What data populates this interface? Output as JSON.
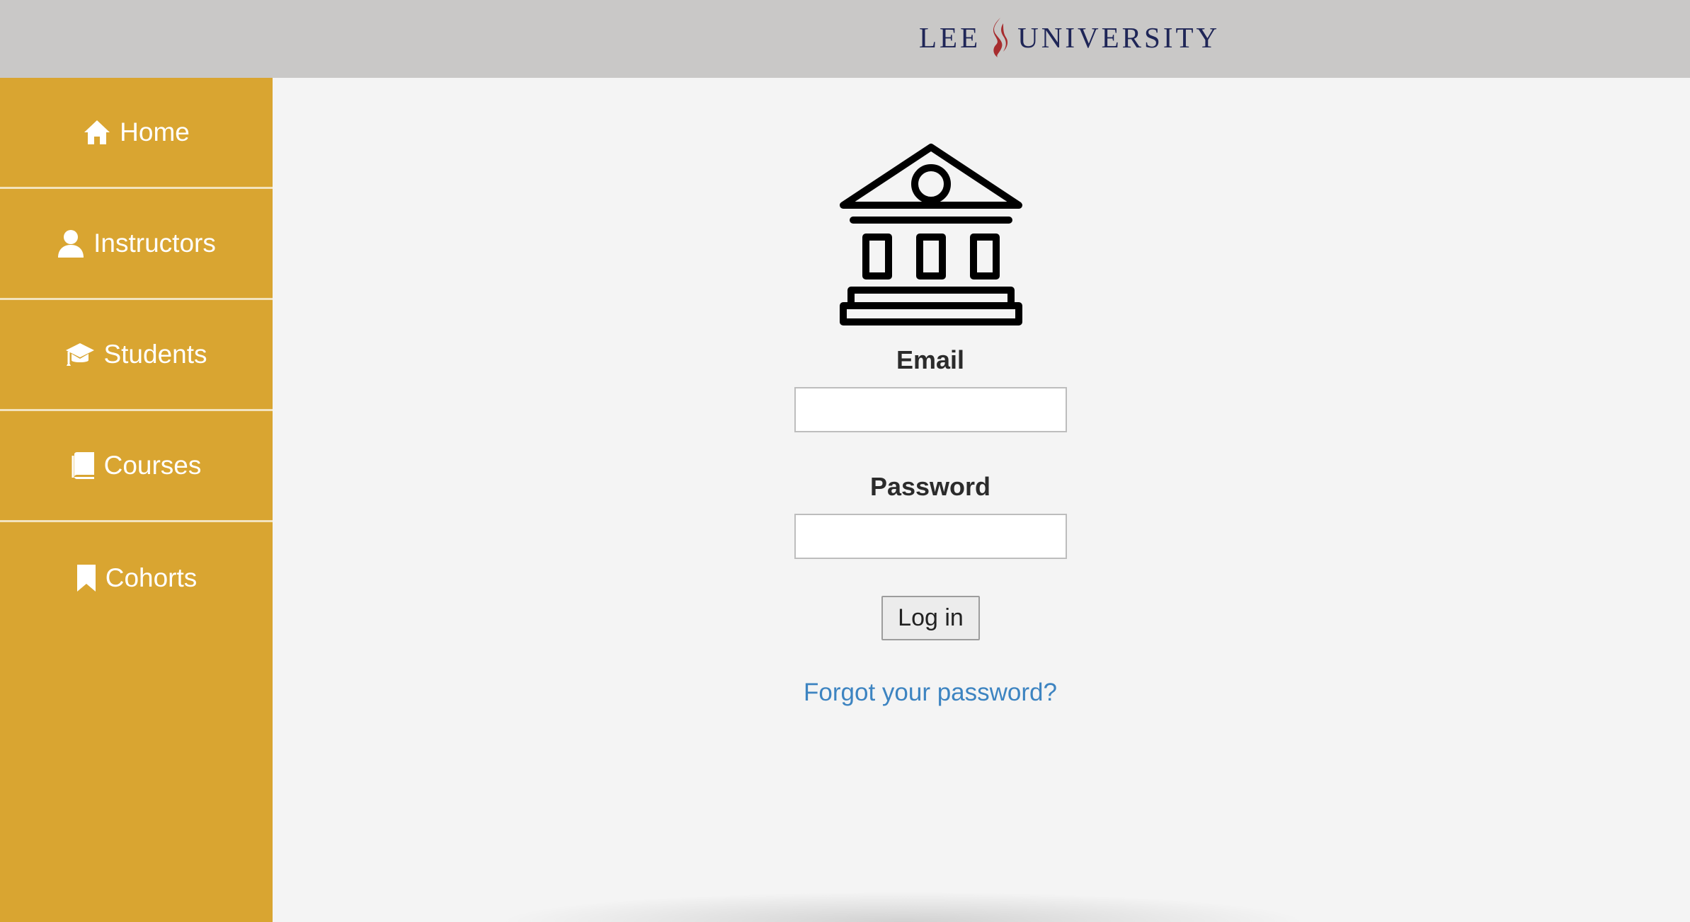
{
  "header": {
    "logo_left": "LEE",
    "logo_right": "UNIVERSITY",
    "logo_icon": "flame-icon",
    "brand_color": "#1f2657",
    "flame_color": "#a72d2f"
  },
  "sidebar": {
    "background": "#d9a531",
    "items": [
      {
        "label": "Home",
        "icon": "home-icon"
      },
      {
        "label": "Instructors",
        "icon": "user-icon"
      },
      {
        "label": "Students",
        "icon": "graduation-cap-icon"
      },
      {
        "label": "Courses",
        "icon": "book-icon"
      },
      {
        "label": "Cohorts",
        "icon": "bookmark-icon"
      }
    ]
  },
  "login": {
    "icon": "university-building-icon",
    "email_label": "Email",
    "email_value": "",
    "password_label": "Password",
    "password_value": "",
    "submit_label": "Log in",
    "forgot_label": "Forgot your password?",
    "link_color": "#3d84c1"
  }
}
